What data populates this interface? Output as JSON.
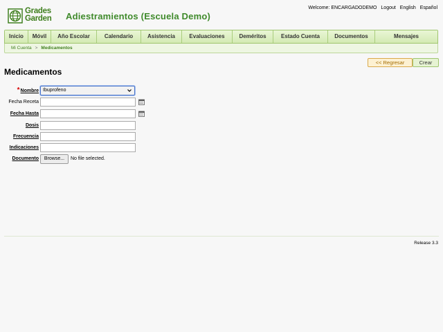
{
  "logo": {
    "line1": "Grades",
    "line2": "Garden"
  },
  "app_title": "Adiestramientos (Escuela Demo)",
  "topbar": {
    "welcome": "Welcome: ENCARGADODEMO",
    "logout": "Logout",
    "english": "English",
    "spanish": "Español"
  },
  "menu": [
    {
      "label": "Inicio"
    },
    {
      "label": "Móvil"
    },
    {
      "label": "Año Escolar"
    },
    {
      "label": "Calendario"
    },
    {
      "label": "Asistencia"
    },
    {
      "label": "Evaluaciones"
    },
    {
      "label": "Deméritos"
    },
    {
      "label": "Estado Cuenta"
    },
    {
      "label": "Documentos"
    },
    {
      "label": "Mensajes"
    }
  ],
  "breadcrumb": {
    "parent": "Mi Cuenta",
    "separator": ">",
    "current": "Medicamentos"
  },
  "actions": {
    "back": "<< Regresar",
    "create": "Crear"
  },
  "page_title": "Medicamentos",
  "form": {
    "required_marker": "*",
    "nombre": {
      "label": "Nombre",
      "value": "Ibuprofeno"
    },
    "fecha_receta": {
      "label": "Fecha Receta",
      "value": ""
    },
    "fecha_hasta": {
      "label": "Fecha Hasta",
      "value": ""
    },
    "dosis": {
      "label": "Dosis",
      "value": ""
    },
    "frecuencia": {
      "label": "Frecuencia",
      "value": ""
    },
    "indicaciones": {
      "label": "Indicaciones",
      "value": ""
    },
    "documento": {
      "label": "Documento",
      "browse": "Browse...",
      "status": "No file selected."
    }
  },
  "footer": {
    "release": "Release 3.3"
  },
  "colors": {
    "brand_green": "#3f8a2b",
    "menu_bg": "#dff0c3",
    "required_red": "#d60000"
  }
}
